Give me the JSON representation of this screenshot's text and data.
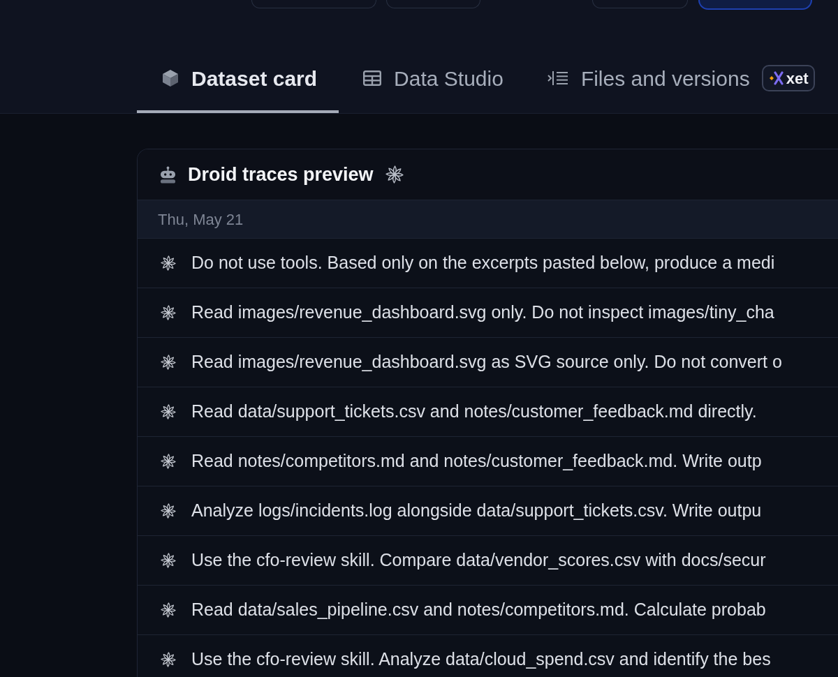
{
  "top_buttons": [
    {
      "kind": "outline"
    },
    {
      "kind": "outline"
    },
    {
      "kind": "outline"
    },
    {
      "kind": "primary"
    }
  ],
  "tabs": [
    {
      "label": "Dataset card",
      "selected": true
    },
    {
      "label": "Data Studio",
      "selected": false
    },
    {
      "label": "Files and versions",
      "selected": false,
      "badge": "xet"
    }
  ],
  "preview": {
    "title": "Droid traces preview",
    "date_group": "Thu, May 21",
    "traces": [
      {
        "text": "Do not use tools. Based only on the excerpts pasted below, produce a medi"
      },
      {
        "text": "Read images/revenue_dashboard.svg only. Do not inspect images/tiny_cha"
      },
      {
        "text": "Read images/revenue_dashboard.svg as SVG source only. Do not convert o"
      },
      {
        "text": "Read data/support_tickets.csv and notes/customer_feedback.md directly."
      },
      {
        "text": "Read notes/competitors.md and notes/customer_feedback.md. Write outp"
      },
      {
        "text": "Analyze logs/incidents.log alongside data/support_tickets.csv. Write outpu"
      },
      {
        "text": "Use the cfo-review skill. Compare data/vendor_scores.csv with docs/secur"
      },
      {
        "text": "Read data/sales_pipeline.csv and notes/competitors.md. Calculate probab"
      },
      {
        "text": "Use the cfo-review skill. Analyze data/cloud_spend.csv and identify the bes"
      }
    ]
  }
}
